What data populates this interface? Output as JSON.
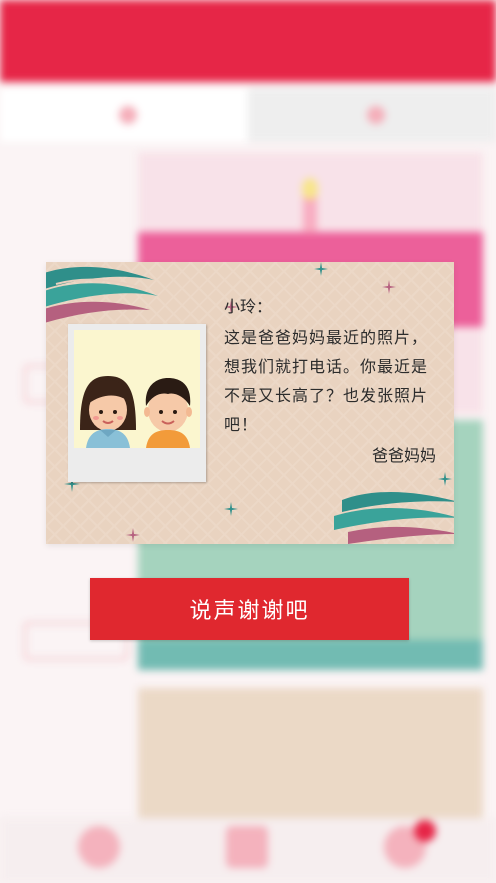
{
  "card": {
    "greeting": "小玲：",
    "message": "这是爸爸妈妈最近的照片，想我们就打电话。你最近是不是又长高了？也发张照片吧！",
    "signature": "爸爸妈妈"
  },
  "action": {
    "thanks_label": "说声谢谢吧"
  },
  "colors": {
    "brand_red": "#e3082e",
    "button_red": "#e0282f",
    "card_beige": "#e9d3c0"
  }
}
